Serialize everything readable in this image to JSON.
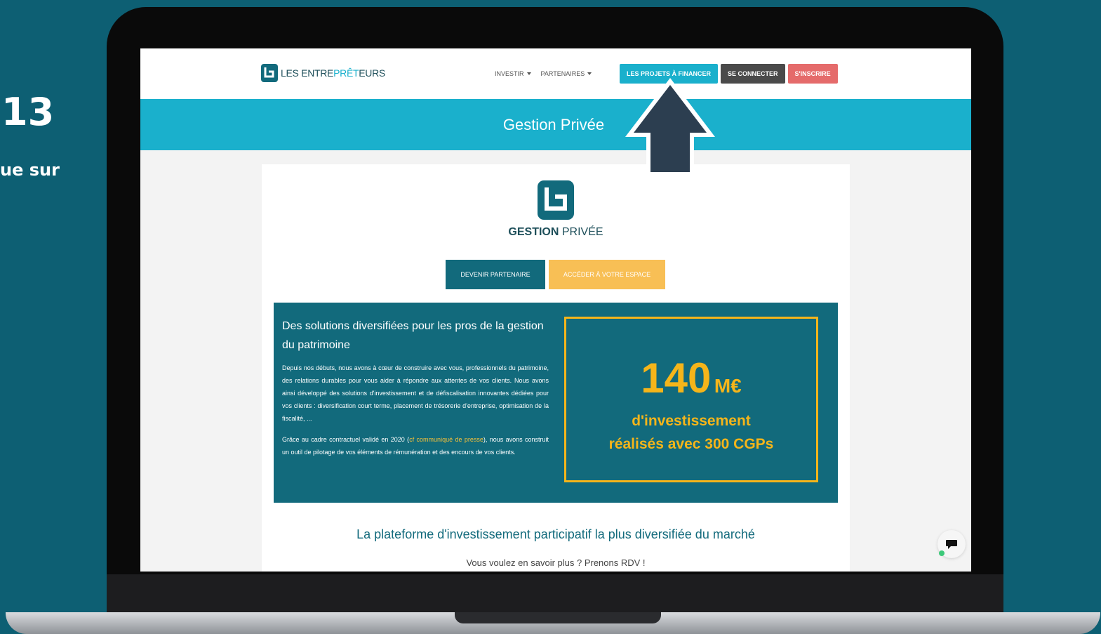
{
  "slide": {
    "step_number": "13",
    "caption_partial": "ue sur"
  },
  "browser": {
    "brand": {
      "prefix": "LES ENTRE",
      "accent": "PRÊT",
      "suffix": "EURS"
    },
    "nav": {
      "invest": "INVESTIR",
      "partners": "PARTENAIRES"
    },
    "buttons": {
      "projects": "LES PROJETS À FINANCER",
      "login": "SE CONNECTER",
      "signup": "S'INSCRIRE"
    },
    "banner_title": "Gestion Privée"
  },
  "card": {
    "logo": {
      "bold": "GESTION",
      "light": " PRIVÉE"
    },
    "cta_partner": "DEVENIR PARTENAIRE",
    "cta_space": "ACCÉDER À VOTRE ESPACE",
    "box": {
      "title": "Des solutions diversifiées pour les pros de la gestion du patrimoine",
      "p1": "Depuis nos débuts, nous avons à cœur de construire avec vous, professionnels du patrimoine, des relations durables pour vous aider à répondre aux attentes de vos clients. Nous avons ainsi développé des solutions d'investissement et de défiscalisation innovantes dédiées pour vos clients : diversification court terme, placement de trésorerie d'entreprise, optimisation de la fiscalité, ...",
      "p2_before": "Grâce au cadre contractuel validé en 2020 (",
      "p2_link": "cf communiqué de presse",
      "p2_after": "), nous avons construit un outil de pilotage de vos éléments de rémunération et des encours de vos clients."
    },
    "stat": {
      "value": "140",
      "unit": "M€",
      "line1": "d'investissement",
      "line2": "réalisés avec 300 CGPs"
    },
    "platform_title": "La plateforme d'investissement participatif la plus diversifiée du marché",
    "platform_sub": "Vous voulez en savoir plus ? Prenons RDV !"
  },
  "colors": {
    "background": "#0d5f73",
    "accent": "#1ab0cc",
    "dark_teal": "#126a7c",
    "gold": "#f5b51a",
    "signup": "#e56b6b"
  },
  "icons": [
    "brand-logo-icon",
    "gestion-logo-icon",
    "chat-icon",
    "arrow-up-icon"
  ]
}
